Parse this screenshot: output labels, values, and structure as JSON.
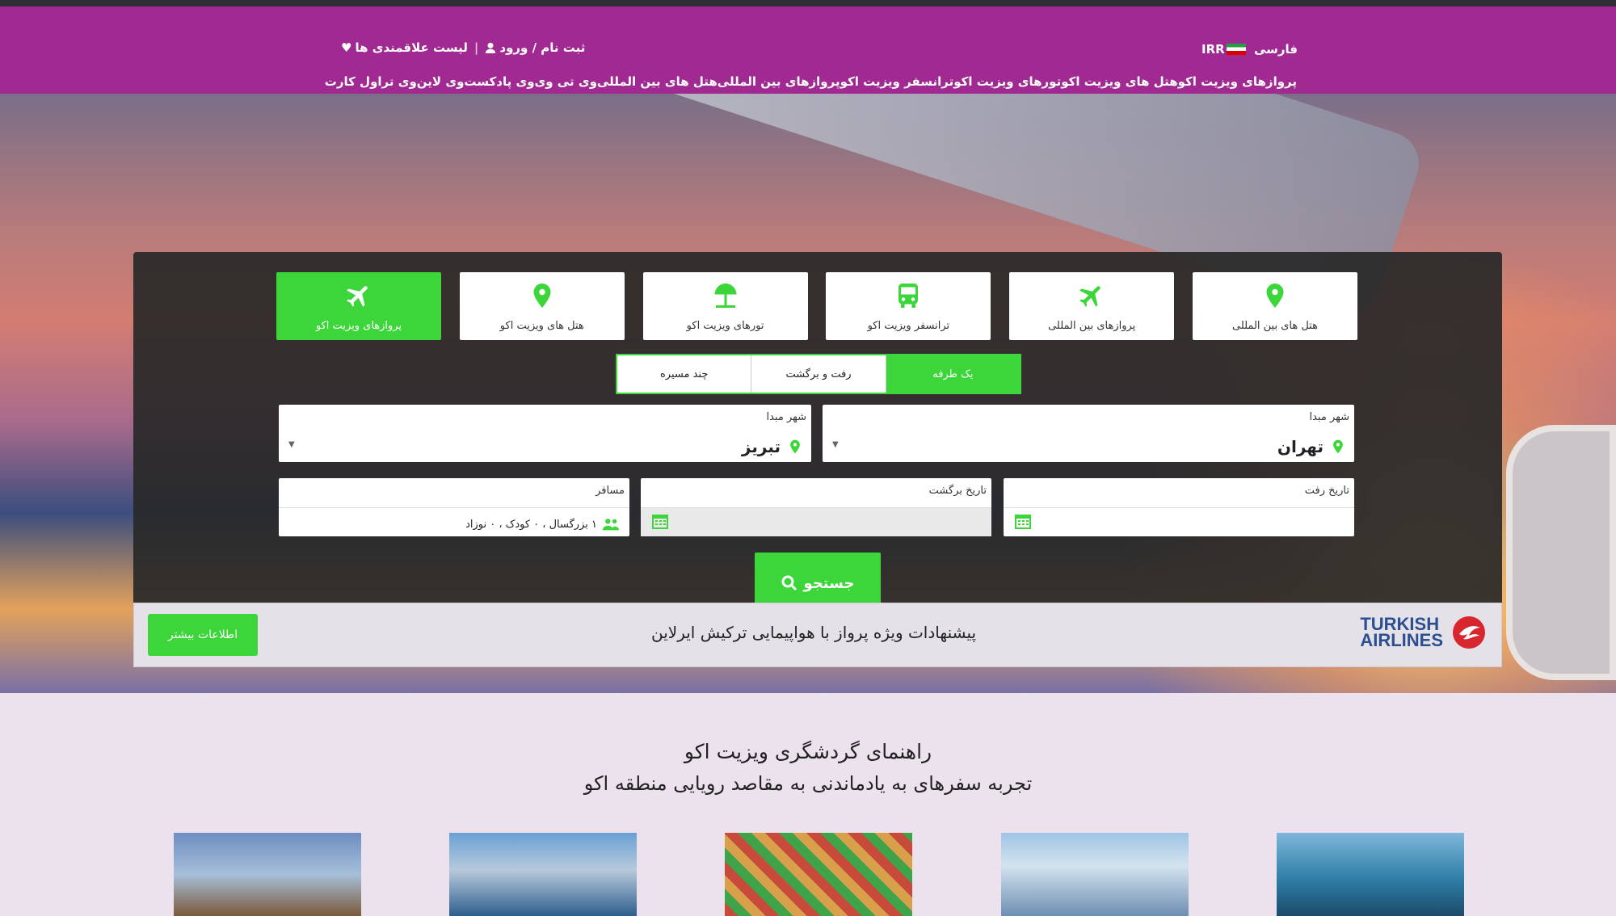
{
  "colors": {
    "topbar": "#a02a91",
    "accent": "#3dd63a",
    "panel": "#282828"
  },
  "header": {
    "language": "فارسی",
    "currency": "IRR",
    "register_login": "ثبت نام / ورود",
    "wishlist": "لیست علاقمندی ها",
    "nav": [
      "پروازهای ویزیت اکو",
      "هتل های ویزیت اکو",
      "تورهای ویزیت اکو",
      "ترانسفر ویزیت اکو",
      "پروازهای بین المللی",
      "هتل های بین المللی",
      "وی تی وی",
      "وی پادکست",
      "وی لاین",
      "وی تراول کارت"
    ]
  },
  "search": {
    "tabs": [
      {
        "label": "پروازهای ویزیت اکو",
        "icon": "plane-icon",
        "active": true
      },
      {
        "label": "هتل های ویزیت اکو",
        "icon": "location-pin-icon"
      },
      {
        "label": "تورهای ویزیت اکو",
        "icon": "beach-umbrella-icon"
      },
      {
        "label": "ترانسفر ویزیت اکو",
        "icon": "bus-icon"
      },
      {
        "label": "پروازهای بین المللی",
        "icon": "plane-icon"
      },
      {
        "label": "هتل های بین المللی",
        "icon": "location-pin-icon"
      }
    ],
    "trip_types": [
      "یک طرفه",
      "رفت و برگشت",
      "چند مسیره"
    ],
    "active_trip_type": "یک طرفه",
    "origin": {
      "label": "شهر مبدا",
      "value": "تهران"
    },
    "destination": {
      "label": "شهر مبدا",
      "value": "تبریز"
    },
    "depart_date": {
      "label": "تاریخ رفت",
      "value": ""
    },
    "return_date": {
      "label": "تاریخ برگشت",
      "value": ""
    },
    "passengers": {
      "label": "مسافر",
      "value": "۱ بزرگسال ، ۰ کودک ، ۰ نوزاد"
    },
    "button": "جستجو"
  },
  "promo": {
    "airline_line1": "TURKISH",
    "airline_line2": "AIRLINES",
    "message": "پیشنهادات ویژه پرواز با هواپیمایی ترکیش ایرلاین",
    "button": "اطلاعات بیشتر"
  },
  "guide": {
    "title": "راهنمای گردشگری ویزیت اکو",
    "subtitle": "تجربه سفرهای به یادماندنی به مقاصد رویایی منطقه اکو"
  }
}
